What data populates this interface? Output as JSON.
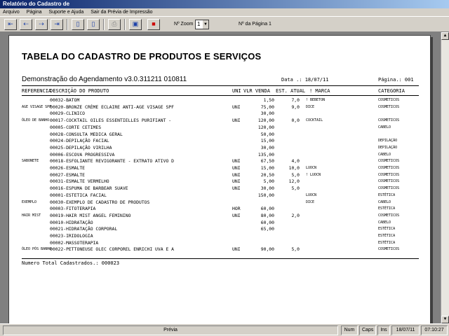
{
  "window": {
    "title": "Relatório do Cadastro de"
  },
  "menu": [
    "Arquivo",
    "Página",
    "Suporte e Ajuda",
    "Sair da Prévia de Impressão"
  ],
  "toolbar": {
    "zoom_label": "Nº Zoom",
    "zoom_value": "1",
    "page_label": "Nº da Página 1"
  },
  "report": {
    "title": "TABELA DO CADASTRO DE PRODUTOS E SERVIÇOS",
    "subtitle": "Demonstração do Agendamento v3.0.311211 010811",
    "date": "Data .: 18/07/11",
    "page": "Página.: 001",
    "columns": {
      "ref": "REFERENCIA",
      "desc": "DESCRIÇÃO DO PRODUTO",
      "uni": "UNI",
      "vlr": "VLR VENDA",
      "est": "EST. ATUAL",
      "marca": "! MARCA",
      "cat": "CATEGORIA"
    },
    "rows": [
      {
        "sub": "",
        "desc": "00032-BATOM",
        "uni": "",
        "vlr": "1,50",
        "est": "7,0",
        "mark": "! BEBETON",
        "cat": "COSMETICOS"
      },
      {
        "sub": "AGE VISAGE SPF",
        "desc": "00020-BRONZE CRÈME ECLAIRE ANTI-AGE VISAGE SPF",
        "uni": "UNI",
        "vlr": "75,00",
        "est": "9,0",
        "mark": "DICE",
        "cat": "COSMETICOS"
      },
      {
        "sub": "",
        "desc": "00029-CLINICO",
        "uni": "",
        "vlr": "30,00",
        "est": "",
        "mark": "",
        "cat": ""
      },
      {
        "sub": "ÓLEO DE BANHO",
        "desc": "00017-COCKTAIL OILES ESSENTIELLES PURIFIANT -",
        "uni": "UNI",
        "vlr": "120,00",
        "est": "0,0",
        "mark": "COCKTAIL",
        "cat": "COSMETICOS"
      },
      {
        "sub": "",
        "desc": "00005-CORTE CETIMES",
        "uni": "",
        "vlr": "120,00",
        "est": "",
        "mark": "",
        "cat": "CABELO"
      },
      {
        "sub": "",
        "desc": "00028-CONSULTA MEDICA GERAL",
        "uni": "",
        "vlr": "50,00",
        "est": "",
        "mark": "",
        "cat": ""
      },
      {
        "sub": "",
        "desc": "00024-DEPILAÇÃO FACIAL",
        "uni": "",
        "vlr": "15,00",
        "est": "",
        "mark": "",
        "cat": "DEPILAÇÃO"
      },
      {
        "sub": "",
        "desc": "00025-DEPILAÇÃO VIRILHA",
        "uni": "",
        "vlr": "30,00",
        "est": "",
        "mark": "",
        "cat": "DEPILAÇÃO"
      },
      {
        "sub": "",
        "desc": "00006-ESCOVA PROGRESSIVA",
        "uni": "",
        "vlr": "135,00",
        "est": "",
        "mark": "",
        "cat": "CABELO"
      },
      {
        "sub": "SABONETE",
        "desc": "00018-ESFOLIANTE REVIGORANTE - EXTRATO ATIVO D",
        "uni": "UNI",
        "vlr": "67,50",
        "est": "4,0",
        "mark": "",
        "cat": "COSMETICOS"
      },
      {
        "sub": "",
        "desc": "00026-ESMALTE",
        "uni": "UNI",
        "vlr": "15,00",
        "est": "10,0",
        "mark": "LUOCN",
        "cat": "COSMETICOS"
      },
      {
        "sub": "",
        "desc": "00027-ESMALTE",
        "uni": "UNI",
        "vlr": "20,50",
        "est": "5,0",
        "mark": "! LUOCN",
        "cat": "COSMETICOS"
      },
      {
        "sub": "",
        "desc": "00031-ESMALTE VERMELHO",
        "uni": "UNI",
        "vlr": "5,00",
        "est": "12,0",
        "mark": "",
        "cat": "COSMETICOS"
      },
      {
        "sub": "",
        "desc": "00016-ESPUMA DE BARBEAR SUAVE",
        "uni": "UNI",
        "vlr": "30,00",
        "est": "5,0",
        "mark": "",
        "cat": "COSMETICOS"
      },
      {
        "sub": "",
        "desc": "00001-ESTETICA FACIAL",
        "uni": "",
        "vlr": "150,00",
        "est": "",
        "mark": "LUOCN",
        "cat": "ESTÉTICA"
      },
      {
        "sub": "EXEMPLO",
        "desc": "00030-EXEMPLO DE CADASTRO DE PRODUTOS",
        "uni": "",
        "vlr": "",
        "est": "",
        "mark": "DICE",
        "cat": "CABELO"
      },
      {
        "sub": "",
        "desc": "00003-FITOTERAPIA",
        "uni": "HOR",
        "vlr": "60,00",
        "est": "",
        "mark": "",
        "cat": "ESTÉTICA"
      },
      {
        "sub": "HAIR MIST",
        "desc": "00019-HAIR MIST ANGEL FEMININO",
        "uni": "UNI",
        "vlr": "80,00",
        "est": "2,0",
        "mark": "",
        "cat": "COSMETICOS"
      },
      {
        "sub": "",
        "desc": "00010-HIDRATAÇÃO",
        "uni": "",
        "vlr": "60,00",
        "est": "",
        "mark": "",
        "cat": "CABELO"
      },
      {
        "sub": "",
        "desc": "00021-HIDRATAÇÃO CORPORAL",
        "uni": "",
        "vlr": "65,00",
        "est": "",
        "mark": "",
        "cat": "ESTÉTICA"
      },
      {
        "sub": "",
        "desc": "00023-IRIDOLOGIA",
        "uni": "",
        "vlr": "",
        "est": "",
        "mark": "",
        "cat": "ESTÉTICA"
      },
      {
        "sub": "",
        "desc": "00002-MASSOTERAPIA",
        "uni": "",
        "vlr": "",
        "est": "",
        "mark": "",
        "cat": "ESTÉTICA"
      },
      {
        "sub": "ÓLEO PÓS BANHO",
        "desc": "00022-PETTONEUSE OLEC CORPOREL ENRICHI UVA E A",
        "uni": "UNI",
        "vlr": "90,00",
        "est": "5,0",
        "mark": "",
        "cat": "COSMETICOS"
      }
    ],
    "total": "Numero Total Cadastrados.: 000023"
  },
  "status": {
    "center": "Prévia",
    "num": "Num",
    "caps": "Caps",
    "ins": "Ins",
    "date": "18/07/11",
    "time": "07:10:27"
  }
}
